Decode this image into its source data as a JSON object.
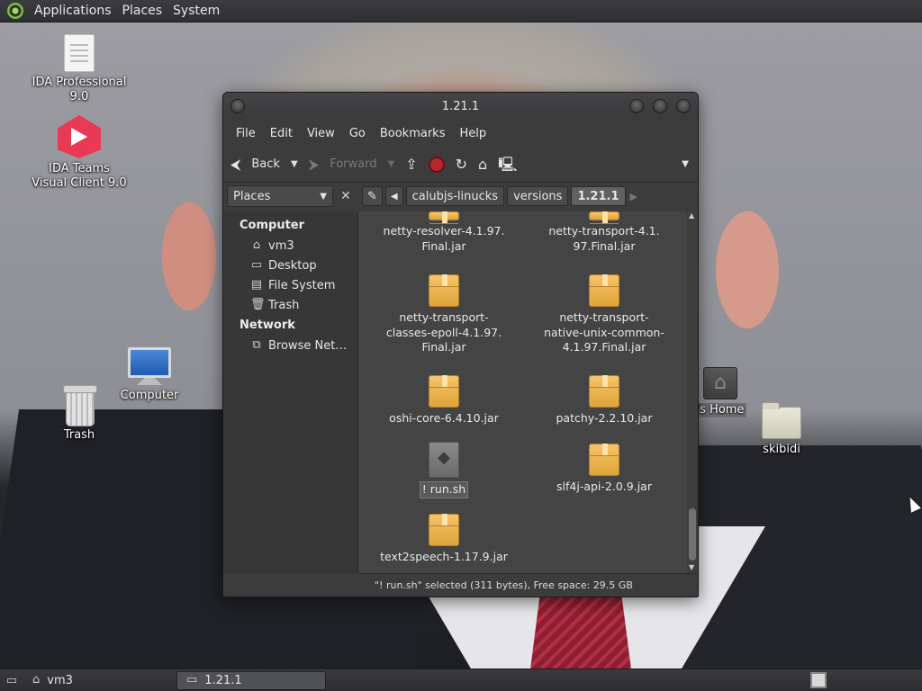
{
  "top_panel": {
    "menus": [
      "Applications",
      "Places",
      "System"
    ]
  },
  "desktop": {
    "icons": {
      "ida_pro": "IDA Professional 9.0",
      "ida_teams": "IDA Teams Visual Client 9.0",
      "computer": "Computer",
      "trash": "Trash",
      "home": "'s Home",
      "skibidi": "skibidi"
    }
  },
  "window": {
    "title": "1.21.1",
    "menus": [
      "File",
      "Edit",
      "View",
      "Go",
      "Bookmarks",
      "Help"
    ],
    "toolbar": {
      "back": "Back",
      "forward": "Forward"
    },
    "sidebar": {
      "selector": "Places",
      "computer_heading": "Computer",
      "computer_items": [
        "vm3",
        "Desktop",
        "File System",
        "Trash"
      ],
      "network_heading": "Network",
      "network_items": [
        "Browse Net…"
      ]
    },
    "breadcrumbs": [
      "calubjs-linucks",
      "versions",
      "1.21.1"
    ],
    "files": [
      {
        "name": "netty-resolver-4.1.97.\nFinal.jar",
        "type": "package"
      },
      {
        "name": "netty-transport-4.1.\n97.Final.jar",
        "type": "package"
      },
      {
        "name": "netty-transport-\nclasses-epoll-4.1.97.\nFinal.jar",
        "type": "package"
      },
      {
        "name": "netty-transport-\nnative-unix-common-\n4.1.97.Final.jar",
        "type": "package"
      },
      {
        "name": "oshi-core-6.4.10.jar",
        "type": "package"
      },
      {
        "name": "patchy-2.2.10.jar",
        "type": "package"
      },
      {
        "name": "! run.sh",
        "type": "script",
        "selected": true
      },
      {
        "name": "slf4j-api-2.0.9.jar",
        "type": "package"
      },
      {
        "name": "text2speech-1.17.9.jar",
        "type": "package"
      }
    ],
    "status": "\"! run.sh\" selected (311 bytes), Free space: 29.5 GB"
  },
  "taskbar": {
    "tasks": [
      "vm3",
      "1.21.1"
    ]
  }
}
